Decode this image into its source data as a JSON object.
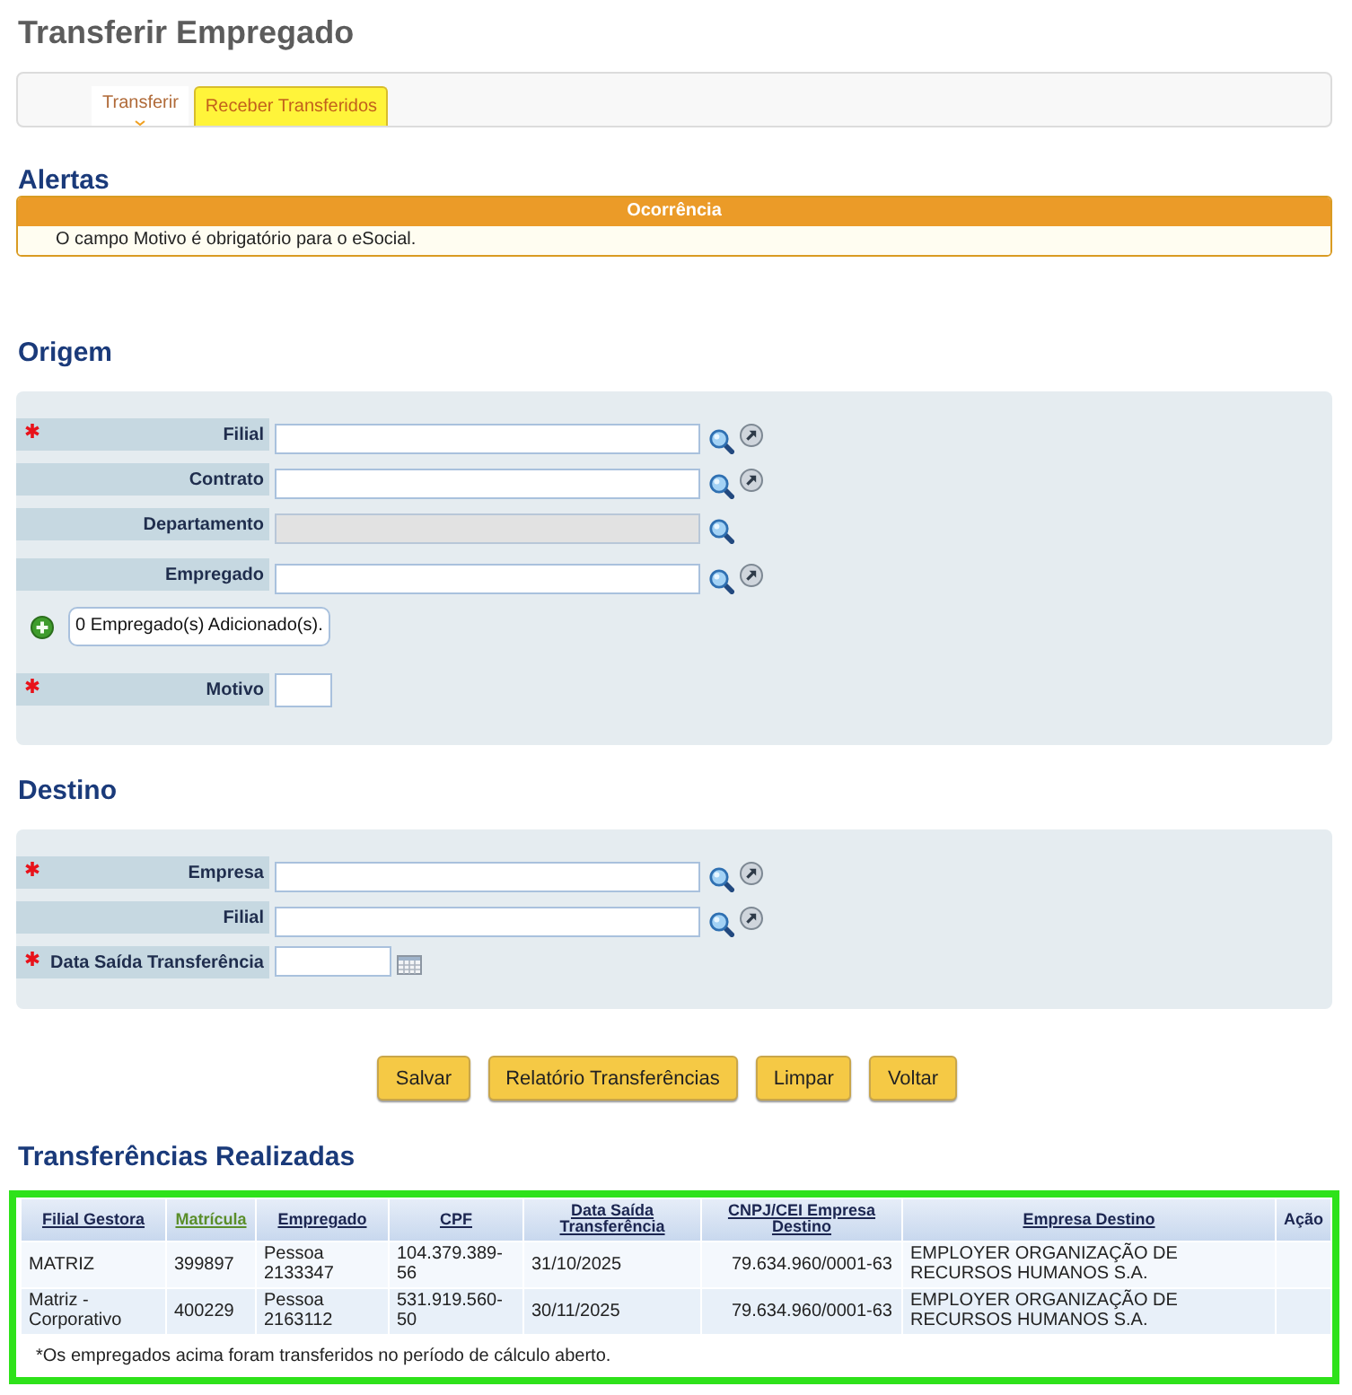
{
  "page": {
    "title": "Transferir Empregado"
  },
  "tabs": [
    {
      "label": "Transferir",
      "selected": true
    },
    {
      "label": "Receber Transferidos",
      "selected": false
    }
  ],
  "alerts": {
    "heading": "Alertas",
    "column": "Ocorrência",
    "messages": [
      "O campo Motivo é obrigatório para o eSocial."
    ]
  },
  "origin": {
    "heading": "Origem",
    "groups": [
      [
        {
          "kind": "lookup",
          "label": "Filial",
          "required": true,
          "disabled": false
        },
        {
          "kind": "lookup",
          "label": "Contrato",
          "required": false,
          "disabled": false
        },
        {
          "kind": "search",
          "label": "Departamento",
          "required": false,
          "disabled": true
        }
      ],
      [
        {
          "kind": "lookup",
          "label": "Empregado",
          "required": false,
          "disabled": false
        },
        {
          "kind": "counter",
          "text": "0 Empregado(s) Adicionado(s)."
        }
      ],
      [
        {
          "kind": "short",
          "label": "Motivo",
          "required": true,
          "disabled": false
        }
      ]
    ]
  },
  "destination": {
    "heading": "Destino",
    "groups": [
      [
        {
          "kind": "lookup",
          "label": "Empresa",
          "required": true,
          "disabled": false
        },
        {
          "kind": "lookup",
          "label": "Filial",
          "required": false,
          "disabled": false
        },
        {
          "kind": "date",
          "label": "Data Saída Transferência",
          "required": true,
          "disabled": false
        }
      ]
    ]
  },
  "buttons": [
    "Salvar",
    "Relatório Transferências",
    "Limpar",
    "Voltar"
  ],
  "transfers": {
    "heading": "Transferências Realizadas",
    "highlighted": true,
    "columns": [
      {
        "label": "Filial Gestora",
        "sortable": true,
        "sorted": false
      },
      {
        "label": "Matrícula",
        "sortable": true,
        "sorted": true
      },
      {
        "label": "Empregado",
        "sortable": true,
        "sorted": false
      },
      {
        "label": "CPF",
        "sortable": true,
        "sorted": false
      },
      {
        "label": "Data Saída Transferência",
        "sortable": true,
        "sorted": false
      },
      {
        "label": "CNPJ/CEI Empresa Destino",
        "sortable": true,
        "sorted": false
      },
      {
        "label": "Empresa Destino",
        "sortable": true,
        "sorted": false
      },
      {
        "label": "Ação",
        "sortable": false,
        "sorted": false
      }
    ],
    "rows": [
      [
        "MATRIZ",
        "399897",
        "Pessoa 2133347",
        "104.379.389-56",
        "31/10/2025",
        "79.634.960/0001-63",
        "EMPLOYER ORGANIZAÇÃO DE RECURSOS HUMANOS S.A."
      ],
      [
        "Matriz - Corporativo",
        "400229",
        "Pessoa 2163112",
        "531.919.560-50",
        "30/11/2025",
        "79.634.960/0001-63",
        "EMPLOYER ORGANIZAÇÃO DE RECURSOS HUMANOS S.A."
      ]
    ],
    "footnote": "*Os empregados acima foram transferidos no período de cálculo aberto."
  }
}
